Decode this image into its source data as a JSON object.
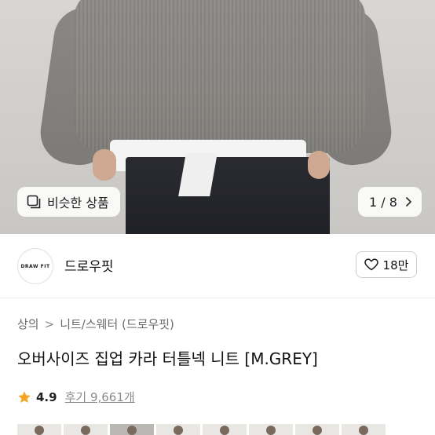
{
  "hero": {
    "similar_label": "비슷한 상품",
    "counter": "1 / 8"
  },
  "store": {
    "logo_text": "DRAW FIT",
    "name": "드로우핏",
    "likes": "18만"
  },
  "breadcrumb": {
    "items": [
      "상의",
      "니트/스웨터 (드로우핏)"
    ],
    "separator": ">"
  },
  "product": {
    "title": "오버사이즈 집업 카라 터틀넥 니트 [M.GREY]"
  },
  "rating": {
    "score": "4.9",
    "reviews": "후기 9,661개",
    "star_color": "#f5a623"
  },
  "thumbnails": {
    "count": 8,
    "active_index": 2
  },
  "icons": {
    "similar": "similar-items-icon",
    "next": "chevron-right-icon",
    "like": "heart-icon",
    "star": "star-icon"
  }
}
